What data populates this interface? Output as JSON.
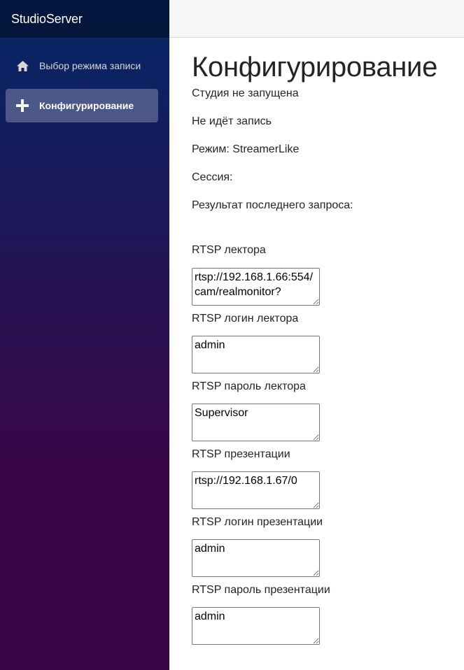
{
  "app": {
    "brand": "StudioServer"
  },
  "nav": {
    "items": [
      {
        "label": "Выбор режима записи",
        "icon": "home-icon",
        "active": false
      },
      {
        "label": "Конфигурирование",
        "icon": "plus-icon",
        "active": true
      }
    ]
  },
  "page": {
    "title": "Конфигурирование",
    "status_studio": "Студия не запущена",
    "status_recording": "Не идёт запись",
    "mode": "Режим: StreamerLike",
    "session": "Сессия:",
    "last_result": "Результат последнего запроса:"
  },
  "fields": {
    "lector_rtsp": {
      "label": "RTSP лектора",
      "value": "rtsp://192.168.1.66:554/cam/realmonitor?"
    },
    "lector_login": {
      "label": "RTSP логин лектора",
      "value": "admin"
    },
    "lector_password": {
      "label": "RTSP пароль лектора",
      "value": "Supervisor"
    },
    "presentation_rtsp": {
      "label": "RTSP презентации",
      "value": "rtsp://192.168.1.67/0"
    },
    "presentation_login": {
      "label": "RTSP логин презентации",
      "value": "admin"
    },
    "presentation_password": {
      "label": "RTSP пароль презентации",
      "value": "admin"
    }
  },
  "colors": {
    "sidebar_top": "#052767",
    "sidebar_bottom": "#3a0647",
    "top_row": "#f7f7f7"
  }
}
